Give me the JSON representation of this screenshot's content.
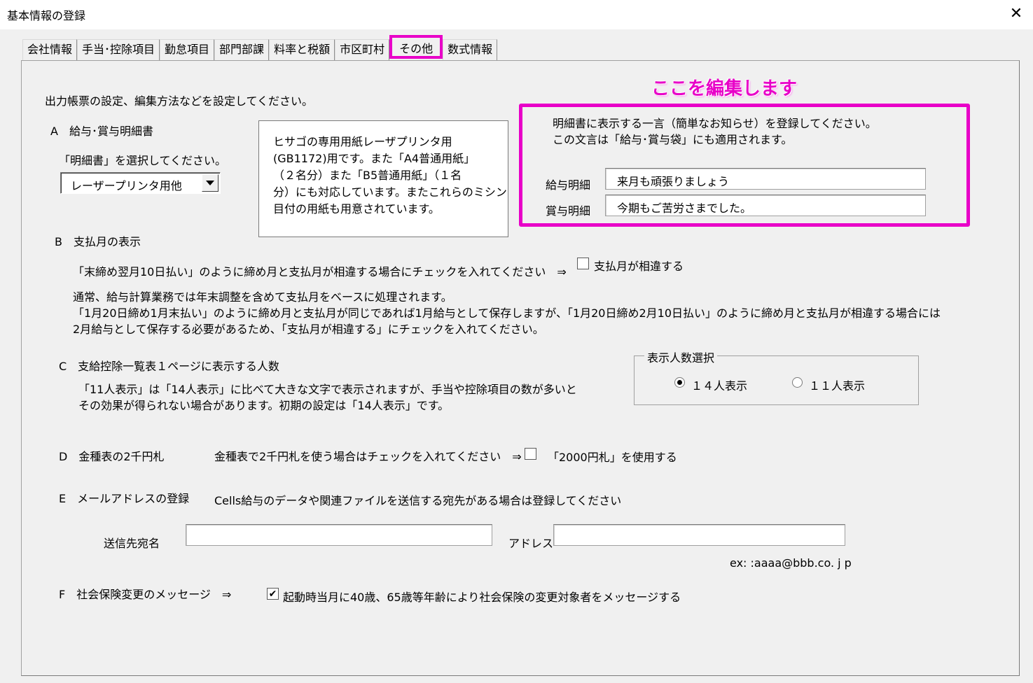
{
  "window": {
    "title": "基本情報の登録",
    "close_glyph": "✕"
  },
  "tabs": [
    {
      "label": "会社情報"
    },
    {
      "label": "手当･控除項目"
    },
    {
      "label": "勤怠項目"
    },
    {
      "label": "部門部課"
    },
    {
      "label": "料率と税額"
    },
    {
      "label": "市区町村"
    },
    {
      "label": "その他",
      "active": true
    },
    {
      "label": "数式情報"
    }
  ],
  "intro": "出力帳票の設定、編集方法などを設定してください。",
  "section_a": {
    "heading": "A　給与･賞与明細書",
    "select_prompt": "「明細書」を選択してください。",
    "combo_value": "レーザープリンタ用他",
    "info_lines": [
      "ヒサゴの専用用紙レーザプリンタ用",
      "(GB1172)用です。また「A4普通用紙」",
      "（２名分）また「B5普通用紙」（１名",
      "分）にも対応しています。またこれらのミシン",
      "目付の用紙も用意されています。"
    ]
  },
  "annotation": {
    "callout": "ここを編集します",
    "accent_color": "#e800c8"
  },
  "message_section": {
    "line1": "明細書に表示する一言（簡単なお知らせ）を登録してください。",
    "line2": "この文言は「給与･賞与袋」にも適用されます。",
    "salary_label": "給与明細",
    "salary_value": "来月も頑張りましょう",
    "bonus_label": "賞与明細",
    "bonus_value": "今期もご苦労さまでした。"
  },
  "section_b": {
    "heading": "B　支払月の表示",
    "instruction": "「末締め翌月10日払い」のように締め月と支払月が相違する場合にチェックを入れてください　⇒",
    "checkbox_label": "支払月が相違する",
    "checkbox_checked": false,
    "note1": "通常、給与計算業務では年末調整を含めて支払月をベースに処理されます。",
    "note2": "「1月20日締め1月末払い」のように締め月と支払月が同じであれば1月給与として保存しますが、「1月20日締め2月10日払い」のように締め月と支払月が相違する場合には",
    "note3": "2月給与として保存する必要があるため、「支払月が相違する」にチェックを入れてください。"
  },
  "section_c": {
    "heading": "C　支給控除一覧表１ページに表示する人数",
    "desc1": "「11人表示」は「14人表示」に比べて大きな文字で表示されますが、手当や控除項目の数が多いと",
    "desc2": "その効果が得られない場合があります。初期の設定は「14人表示」です。",
    "group_title": "表示人数選択",
    "option_14": "１４人表示",
    "option_11": "１１人表示",
    "selected": "14"
  },
  "section_d": {
    "heading": "D　金種表の2千円札",
    "instruction": "金種表で2千円札を使う場合はチェックを入れてください　⇒",
    "checkbox_label": "「2000円札」を使用する",
    "checkbox_checked": false
  },
  "section_e": {
    "heading": "E　メールアドレスの登録",
    "instruction": "Cells給与のデータや関連ファイルを送信する宛先がある場合は登録してください",
    "recipient_label": "送信先宛名",
    "recipient_value": "",
    "address_label": "アドレス",
    "address_value": "",
    "example": "ex: :aaaa@bbb.co. j p"
  },
  "section_f": {
    "heading": "F　社会保険変更のメッセージ　⇒",
    "checkbox_label": "起動時当月に40歳、65歳等年齢により社会保険の変更対象者をメッセージする",
    "checkbox_checked": true
  }
}
